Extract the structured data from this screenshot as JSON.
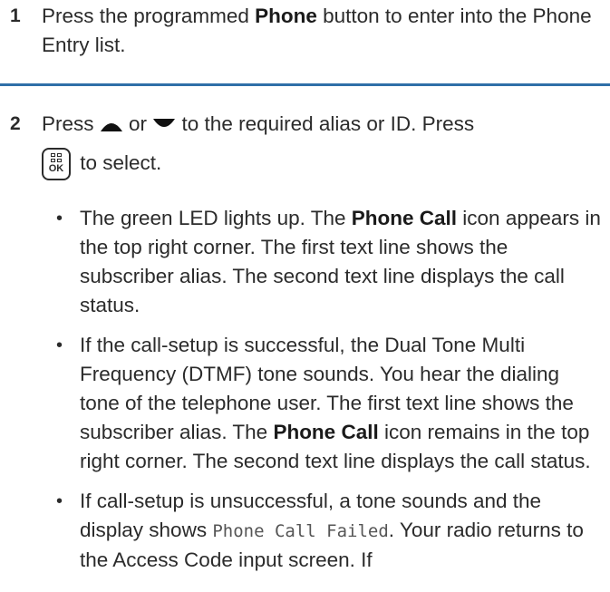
{
  "step1": {
    "number": "1",
    "text_a": "Press the programmed ",
    "text_bold": "Phone",
    "text_b": " button to enter into the Phone Entry list."
  },
  "step2": {
    "number": "2",
    "text_a": "Press ",
    "or_text": " or ",
    "text_b": " to the required alias or ID. Press",
    "ok_label": "OK",
    "text_c": " to select.",
    "up_icon": "triangle-up-icon",
    "down_icon": "triangle-down-icon",
    "ok_icon": "menu-ok-key-icon"
  },
  "bullets": [
    {
      "a": "The green LED lights up. The ",
      "bold": "Phone Call",
      "b": " icon appears in the top right corner. The first text line shows the subscriber alias. The second text line displays the call status."
    },
    {
      "a": "If the call-setup is successful, the Dual Tone Multi Frequency (DTMF) tone sounds. You hear the dialing tone of the telephone user. The first text line shows the subscriber alias. The ",
      "bold": "Phone Call",
      "b": " icon remains in the top right corner. The second text line displays the call status."
    },
    {
      "a": "If call-setup is unsuccessful, a tone sounds and the display shows ",
      "mono": "Phone Call Failed",
      "b": ". Your radio returns to the Access Code input screen. If"
    }
  ],
  "bullet_char": "•",
  "colors": {
    "divider": "#2f6fa8",
    "text": "#2b2b2b"
  }
}
